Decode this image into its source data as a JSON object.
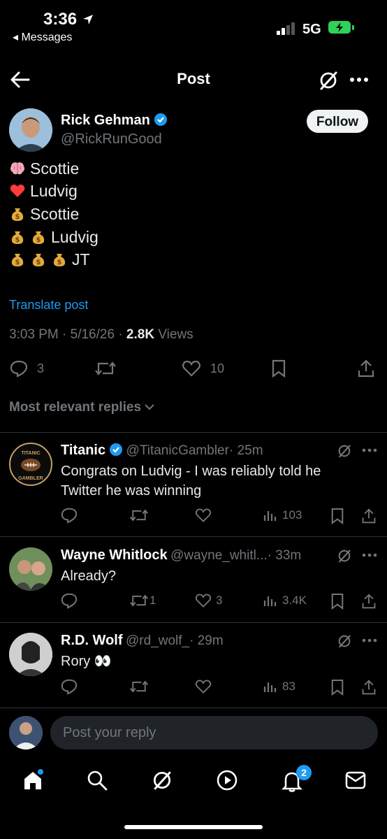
{
  "status_bar": {
    "time": "3:36",
    "back_app": "◂ Messages",
    "network": "5G"
  },
  "header": {
    "title": "Post"
  },
  "post": {
    "author_name": "Rick Gehman",
    "author_handle": "@RickRunGood",
    "follow_label": "Follow",
    "lines": [
      {
        "emoji": [
          "brain"
        ],
        "text": "Scottie"
      },
      {
        "emoji": [
          "heart"
        ],
        "text": "Ludvig"
      },
      {
        "emoji": [
          "money-bag"
        ],
        "text": "Scottie"
      },
      {
        "emoji": [
          "money-bag",
          "money-bag"
        ],
        "text": "Ludvig"
      },
      {
        "emoji": [
          "money-bag",
          "money-bag",
          "money-bag"
        ],
        "text": "JT"
      }
    ],
    "translate": "Translate post",
    "time": "3:03 PM · 5/16/26 · ",
    "views_count": "2.8K",
    "views_label": " Views",
    "replies": "3",
    "likes": "10"
  },
  "replies_filter": "Most relevant replies",
  "replies": [
    {
      "name": "Titanic",
      "verified": true,
      "handle": "@TitanicGambler",
      "age": "· 25m",
      "text": "Congrats on Ludvig - I was reliably told he Twitter he was winning",
      "replies": "",
      "reposts": "",
      "likes": "",
      "views": "103",
      "avatar_text": "TITANIC GAMBLER"
    },
    {
      "name": "Wayne Whitlock",
      "verified": false,
      "handle": "@wayne_whitl...",
      "age": "· 33m",
      "text": "Already?",
      "replies": "",
      "reposts": "1",
      "likes": "3",
      "views": "3.4K"
    },
    {
      "name": "R.D. Wolf",
      "verified": false,
      "handle": "@rd_wolf_",
      "age": "· 29m",
      "text": "Rory 👀",
      "replies": "",
      "reposts": "",
      "likes": "",
      "views": "83"
    }
  ],
  "reply_box": {
    "placeholder": "Post your reply"
  },
  "nav": {
    "notifications_badge": "2"
  },
  "colors": {
    "accent": "#1d9bf0",
    "muted": "#71767b",
    "background": "#000000"
  }
}
